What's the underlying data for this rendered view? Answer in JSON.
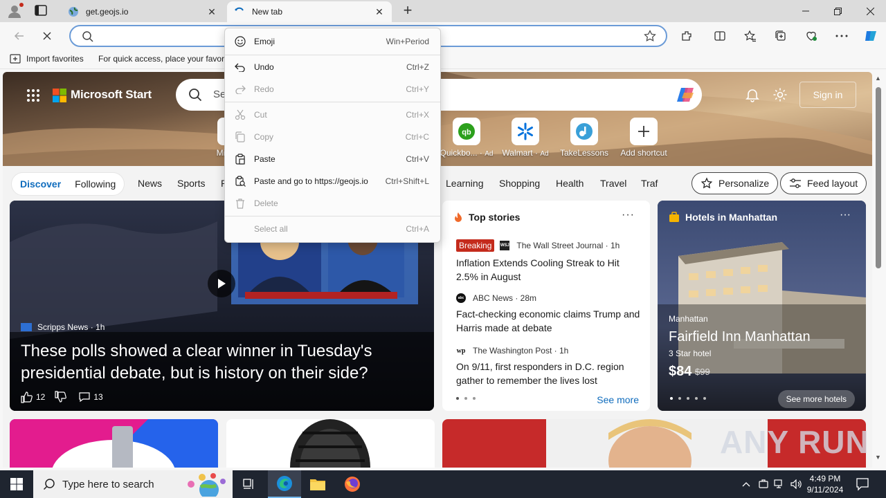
{
  "browser": {
    "tabs": [
      {
        "title": "get.geojs.io",
        "active": false
      },
      {
        "title": "New tab",
        "active": true
      }
    ],
    "address_value": "",
    "favorites_bar": {
      "import_label": "Import favorites",
      "hint": "For quick access, place your favorit"
    }
  },
  "context_menu": {
    "items": [
      {
        "label": "Emoji",
        "shortcut": "Win+Period",
        "enabled": true,
        "icon": "emoji-icon"
      },
      {
        "label": "Undo",
        "shortcut": "Ctrl+Z",
        "enabled": true,
        "icon": "undo-icon"
      },
      {
        "label": "Redo",
        "shortcut": "Ctrl+Y",
        "enabled": false,
        "icon": "redo-icon"
      },
      {
        "label": "Cut",
        "shortcut": "Ctrl+X",
        "enabled": false,
        "icon": "cut-icon"
      },
      {
        "label": "Copy",
        "shortcut": "Ctrl+C",
        "enabled": false,
        "icon": "copy-icon"
      },
      {
        "label": "Paste",
        "shortcut": "Ctrl+V",
        "enabled": true,
        "icon": "paste-icon"
      },
      {
        "label": "Paste and go to https://geojs.io",
        "shortcut": "Ctrl+Shift+L",
        "enabled": true,
        "icon": "paste-go-icon"
      },
      {
        "label": "Delete",
        "shortcut": "",
        "enabled": false,
        "icon": "delete-icon"
      },
      {
        "label": "Select all",
        "shortcut": "Ctrl+A",
        "enabled": false,
        "icon": ""
      }
    ]
  },
  "msn": {
    "brand": "Microsoft Start",
    "search_placeholder": "Se",
    "sign_in": "Sign in",
    "shortcuts": [
      {
        "label": "Micr",
        "ad": ""
      },
      {
        "label": "Quickbo...",
        "ad": "Ad"
      },
      {
        "label": "Walmart",
        "ad": "Ad"
      },
      {
        "label": "TakeLessons",
        "ad": ""
      },
      {
        "label": "Add shortcut",
        "ad": ""
      }
    ],
    "pill_tabs": [
      "Discover",
      "Following"
    ],
    "categories": [
      "News",
      "Sports",
      "P",
      "Learning",
      "Shopping",
      "Health",
      "Travel",
      "Traf"
    ],
    "personalize": "Personalize",
    "feed_layout": "Feed layout",
    "feature": {
      "source": "Scripps News · 1h",
      "headline": "These polls showed a clear winner in Tuesday's presidential debate, but is history on their side?",
      "likes": "12",
      "comments": "13"
    },
    "top_stories": {
      "header": "Top stories",
      "see_more": "See more",
      "items": [
        {
          "badge": "Breaking",
          "publisher_logo": "WSJ",
          "source": "The Wall Street Journal · 1h",
          "title": "Inflation Extends Cooling Streak to Hit 2.5% in August"
        },
        {
          "badge": "",
          "publisher_logo": "abc",
          "source": "ABC News · 28m",
          "title": "Fact-checking economic claims Trump and Harris made at debate"
        },
        {
          "badge": "",
          "publisher_logo": "wp",
          "source": "The Washington Post · 1h",
          "title": "On 9/11, first responders in D.C. region gather to remember the lives lost"
        }
      ]
    },
    "hotels": {
      "header": "Hotels in Manhattan",
      "location": "Manhattan",
      "name": "Fairfield Inn Manhattan",
      "stars": "3 Star hotel",
      "price": "$84",
      "old_price": "$99",
      "button": "See more hotels"
    }
  },
  "watermark": "ANY RUN",
  "taskbar": {
    "search_placeholder": "Type here to search",
    "time": "4:49 PM",
    "date": "9/11/2024"
  },
  "colors": {
    "accent": "#0f6cbd",
    "breaking": "#c42b1c",
    "taskbar": "#1f2530"
  }
}
